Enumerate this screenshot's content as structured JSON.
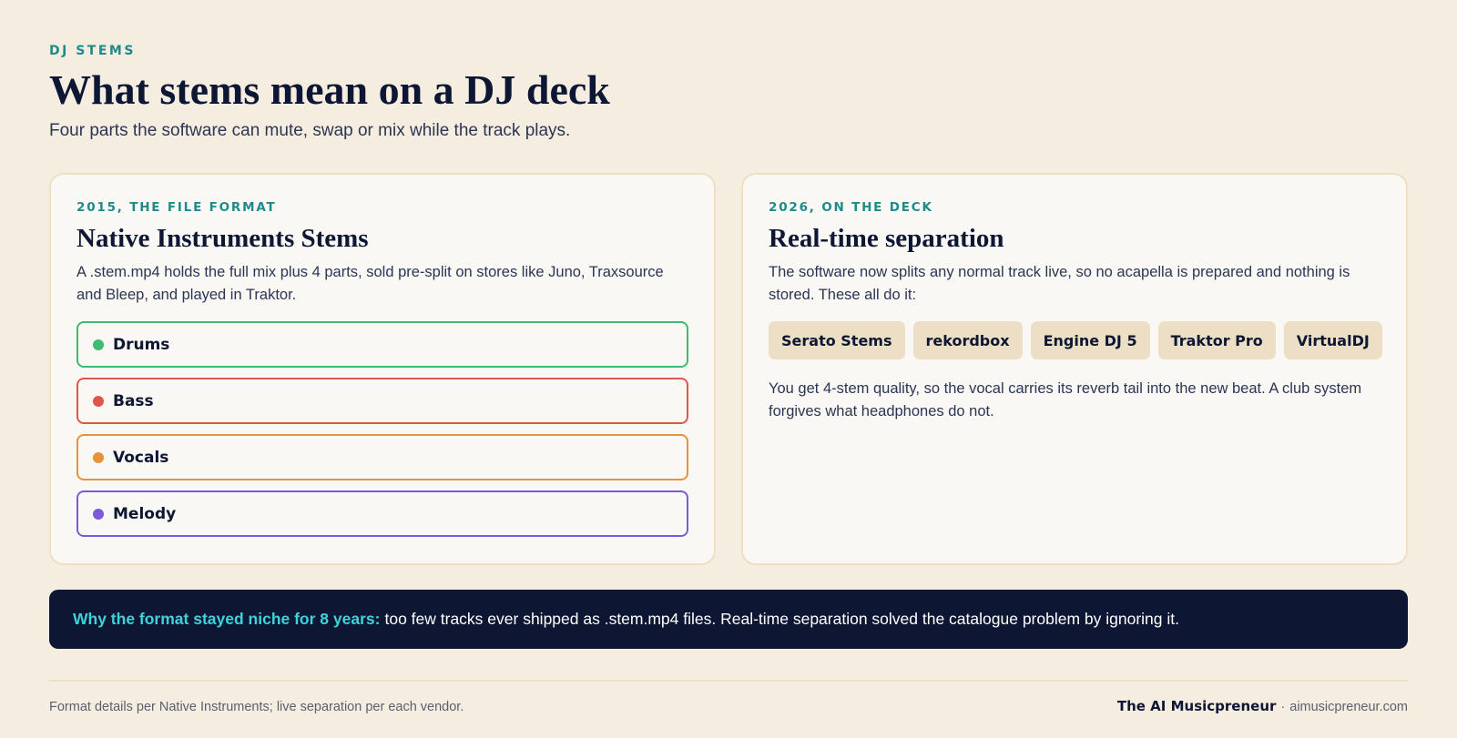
{
  "header": {
    "eyebrow": "DJ STEMS",
    "title": "What stems mean on a DJ deck",
    "subtitle": "Four parts the software can mute, swap or mix while the track plays."
  },
  "left_card": {
    "eyebrow": "2015, THE FILE FORMAT",
    "title": "Native Instruments Stems",
    "description": "A .stem.mp4 holds the full mix plus 4 parts, sold pre-split on stores like Juno, Traxsource and Bleep, and played in Traktor.",
    "stems": [
      {
        "label": "Drums",
        "color": "#3dbb6e"
      },
      {
        "label": "Bass",
        "color": "#e0554a"
      },
      {
        "label": "Vocals",
        "color": "#e8923a"
      },
      {
        "label": "Melody",
        "color": "#7b5ad8"
      }
    ]
  },
  "right_card": {
    "eyebrow": "2026, ON THE DECK",
    "title": "Real-time separation",
    "description": "The software now splits any normal track live, so no acapella is prepared and nothing is stored. These all do it:",
    "chips": [
      "Serato Stems",
      "rekordbox",
      "Engine DJ 5",
      "Traktor Pro",
      "VirtualDJ"
    ],
    "note": "You get 4-stem quality, so the vocal carries its reverb tail into the new beat. A club system forgives what headphones do not."
  },
  "banner": {
    "lead": "Why the format stayed niche for 8 years:",
    "text": "too few tracks ever shipped as .stem.mp4 files. Real-time separation solved the catalogue problem by ignoring it."
  },
  "footer": {
    "source": "Format details per Native Instruments; live separation per each vendor.",
    "brand": "The AI Musicpreneur",
    "separator": "·",
    "site": "aimusicpreneur.com"
  }
}
